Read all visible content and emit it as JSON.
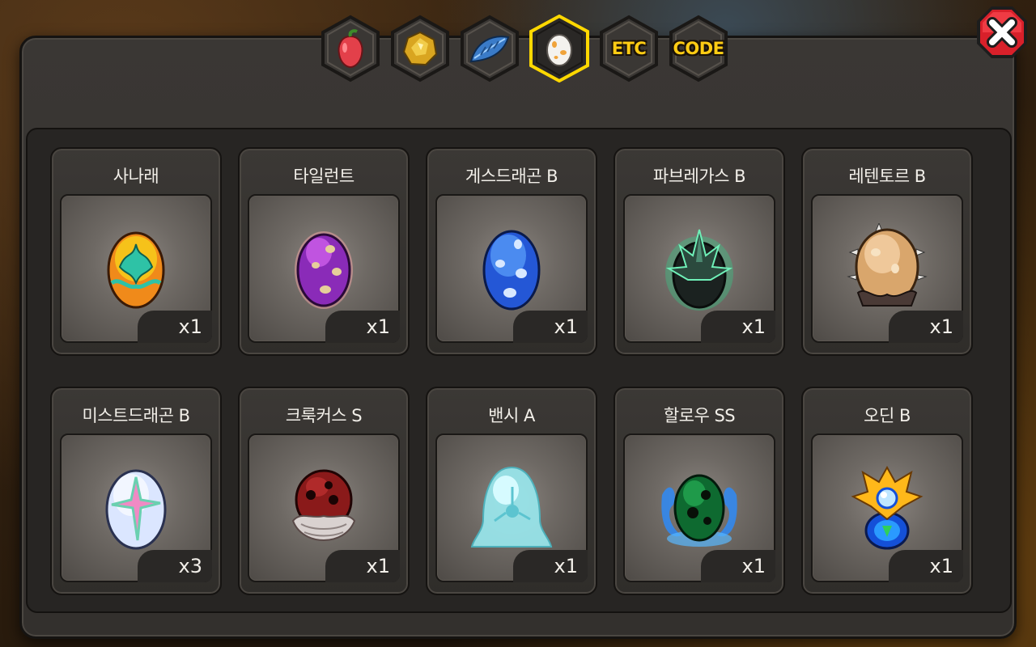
{
  "tabs": [
    {
      "name": "fruit",
      "icon": "fruit-icon",
      "text": ""
    },
    {
      "name": "gold",
      "icon": "gold-ore-icon",
      "text": ""
    },
    {
      "name": "feather",
      "icon": "feather-icon",
      "text": ""
    },
    {
      "name": "egg",
      "icon": "egg-icon",
      "text": "",
      "active": true
    },
    {
      "name": "etc",
      "icon": "",
      "text": "ETC"
    },
    {
      "name": "code",
      "icon": "",
      "text": "CODE"
    }
  ],
  "close_icon": "close-icon",
  "colors": {
    "accent": "#ffd800",
    "close_red": "#d8202a",
    "panel": "#363330"
  },
  "items": [
    {
      "name": "사나래",
      "qty": "x1",
      "egg": "sanarae"
    },
    {
      "name": "타일런트",
      "qty": "x1",
      "egg": "tyrant"
    },
    {
      "name": "게스드래곤 B",
      "qty": "x1",
      "egg": "guessdragon"
    },
    {
      "name": "파브레가스 B",
      "qty": "x1",
      "egg": "fabregas"
    },
    {
      "name": "레텐토르 B",
      "qty": "x1",
      "egg": "retentor"
    },
    {
      "name": "미스트드래곤 B",
      "qty": "x3",
      "egg": "mistdragon"
    },
    {
      "name": "크룩커스 S",
      "qty": "x1",
      "egg": "crookus"
    },
    {
      "name": "밴시 A",
      "qty": "x1",
      "egg": "banshee"
    },
    {
      "name": "할로우 SS",
      "qty": "x1",
      "egg": "hollow"
    },
    {
      "name": "오딘 B",
      "qty": "x1",
      "egg": "odin"
    }
  ]
}
